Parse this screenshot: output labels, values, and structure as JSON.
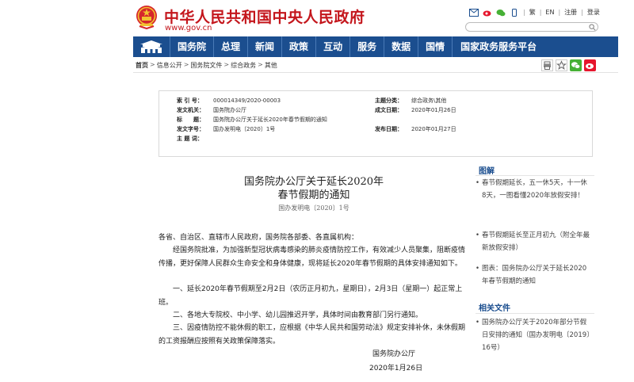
{
  "header": {
    "site_title": "中华人民共和国中央人民政府",
    "site_url": "www.gov.cn",
    "links": [
      "繁",
      "EN",
      "注册",
      "登录"
    ]
  },
  "nav": {
    "items": [
      "国务院",
      "总理",
      "新闻",
      "政策",
      "互动",
      "服务",
      "数据",
      "国情",
      "国家政务服务平台"
    ]
  },
  "breadcrumb": [
    "首页",
    "信息公开",
    "国务院文件",
    "综合政务",
    "其他"
  ],
  "info": {
    "index_k": "索 引 号：",
    "index_v": "000014349/2020-00003",
    "topic_k": "主题分类：",
    "topic_v": "综合政务\\其他",
    "issuer_k": "发文机关：",
    "issuer_v": "国务院办公厅",
    "date_made_k": "成文日期：",
    "date_made_v": "2020年01月26日",
    "title_k": "标　　题：",
    "title_v": "国务院办公厅关于延长2020年春节假期的通知",
    "doc_no_k": "发文字号：",
    "doc_no_v": "国办发明电〔2020〕1号",
    "pub_date_k": "发布日期：",
    "pub_date_v": "2020年01月27日",
    "subject_k": "主 题 词：",
    "subject_v": ""
  },
  "doc": {
    "title_line1": "国务院办公厅关于延长2020年",
    "title_line2": "春节假期的通知",
    "number": "国办发明电〔2020〕1号",
    "p0": "各省、自治区、直辖市人民政府，国务院各部委、各直属机构：",
    "p1": "经国务院批准，为加强新型冠状病毒感染的肺炎疫情防控工作，有效减少人员聚集，阻断疫情传播，更好保障人民群众生命安全和身体健康，现将延长2020年春节假期的具体安排通知如下。",
    "p2": "一、延长2020年春节假期至2月2日（农历正月初九，星期日），2月3日（星期一）起正常上班。",
    "p3": "二、各地大专院校、中小学、幼儿园推迟开学，具体时间由教育部门另行通知。",
    "p4": "三、因疫情防控不能休假的职工，应根据《中华人民共和国劳动法》规定安排补休，未休假期的工资报酬应按照有关政策保障落实。",
    "signer": "国务院办公厅",
    "sign_date": "2020年1月26日"
  },
  "side": {
    "graphic_head": "图解",
    "graphic_items": [
      "春节假期延长，五一休5天，十一休8天，一图看懂2020年放假安排！",
      "春节假期延长至正月初九（附全年最新放假安排）",
      "图表：国务院办公厅关于延长2020年春节假期的通知"
    ],
    "related_head": "相关文件",
    "related_items": [
      "国务院办公厅关于2020年部分节假日安排的通知（国办发明电〔2019〕16号）"
    ]
  },
  "colors": {
    "brand_red": "#c4161c",
    "nav_blue": "#1b4e8f"
  }
}
